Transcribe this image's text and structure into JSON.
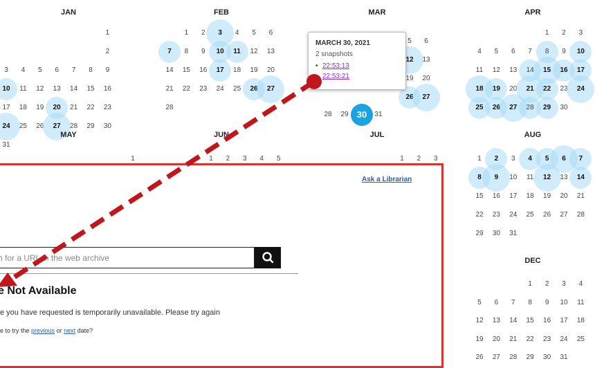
{
  "calendar": {
    "months": [
      {
        "name": "JAN",
        "days": [
          "1",
          "2",
          "3",
          "4",
          "5",
          "6",
          "7",
          "8",
          "9",
          "10",
          "11",
          "12",
          "13",
          "14",
          "15",
          "16",
          "17",
          "18",
          "19",
          "20",
          "21",
          "22",
          "23",
          "24",
          "25",
          "26",
          "27",
          "28",
          "29",
          "30",
          "31"
        ]
      },
      {
        "name": "FEB",
        "days": [
          "1",
          "2",
          "3",
          "4",
          "5",
          "6",
          "7",
          "8",
          "9",
          "10",
          "11",
          "12",
          "13",
          "14",
          "15",
          "16",
          "17",
          "18",
          "19",
          "20",
          "21",
          "22",
          "23",
          "24",
          "25",
          "26",
          "27",
          "28"
        ]
      },
      {
        "name": "MAR",
        "days": [
          "5",
          "6",
          "12",
          "13",
          "19",
          "20",
          "26",
          "27",
          "28",
          "29",
          "30",
          "31"
        ]
      },
      {
        "name": "APR",
        "days": [
          "1",
          "2",
          "3",
          "4",
          "5",
          "6",
          "7",
          "8",
          "9",
          "10",
          "11",
          "12",
          "13",
          "14",
          "15",
          "16",
          "17",
          "18",
          "19",
          "20",
          "21",
          "22",
          "23",
          "24",
          "25",
          "26",
          "27",
          "28",
          "29",
          "30"
        ]
      },
      {
        "name": "MAY",
        "days": [
          "1"
        ]
      },
      {
        "name": "JUN",
        "days": [
          "1",
          "2",
          "3",
          "4",
          "5"
        ]
      },
      {
        "name": "JUL",
        "days": [
          "1",
          "2",
          "3"
        ]
      },
      {
        "name": "AUG",
        "days": [
          "1",
          "2",
          "3",
          "4",
          "5",
          "6",
          "7",
          "8",
          "9",
          "10",
          "11",
          "12",
          "13",
          "14",
          "15",
          "16",
          "17",
          "18",
          "19",
          "20",
          "21",
          "22",
          "23",
          "24",
          "25",
          "26",
          "27",
          "28",
          "29",
          "30",
          "31"
        ]
      },
      {
        "name": "DEC",
        "days": [
          "1",
          "2",
          "3",
          "4",
          "5",
          "6",
          "7",
          "8",
          "9",
          "10",
          "11",
          "12",
          "13",
          "14",
          "15",
          "16",
          "17",
          "18",
          "19",
          "20",
          "21",
          "22",
          "23",
          "24",
          "25",
          "26",
          "27",
          "28",
          "29",
          "30",
          "31"
        ]
      }
    ]
  },
  "popup": {
    "date": "MARCH 30, 2021",
    "count": "2 snapshots",
    "bullet": "•",
    "snapshots": [
      "22:53:13",
      "22:53:21"
    ]
  },
  "page": {
    "ask_librarian": "Ask a Librarian",
    "search_placeholder": "h for a URL in the web archive",
    "title": "e Not Available",
    "message": "e you have requested is temporarily unavailable. Please try again",
    "retry_prefix": "e to try the ",
    "previous_link": "previous",
    "or_text": " or ",
    "next_link": "next",
    "retry_suffix": " date?"
  },
  "colors": {
    "frame": "#e0312b",
    "arrow": "#c0161c",
    "selected_day": "#1aa3e0",
    "bubble": "#aadcf5"
  }
}
